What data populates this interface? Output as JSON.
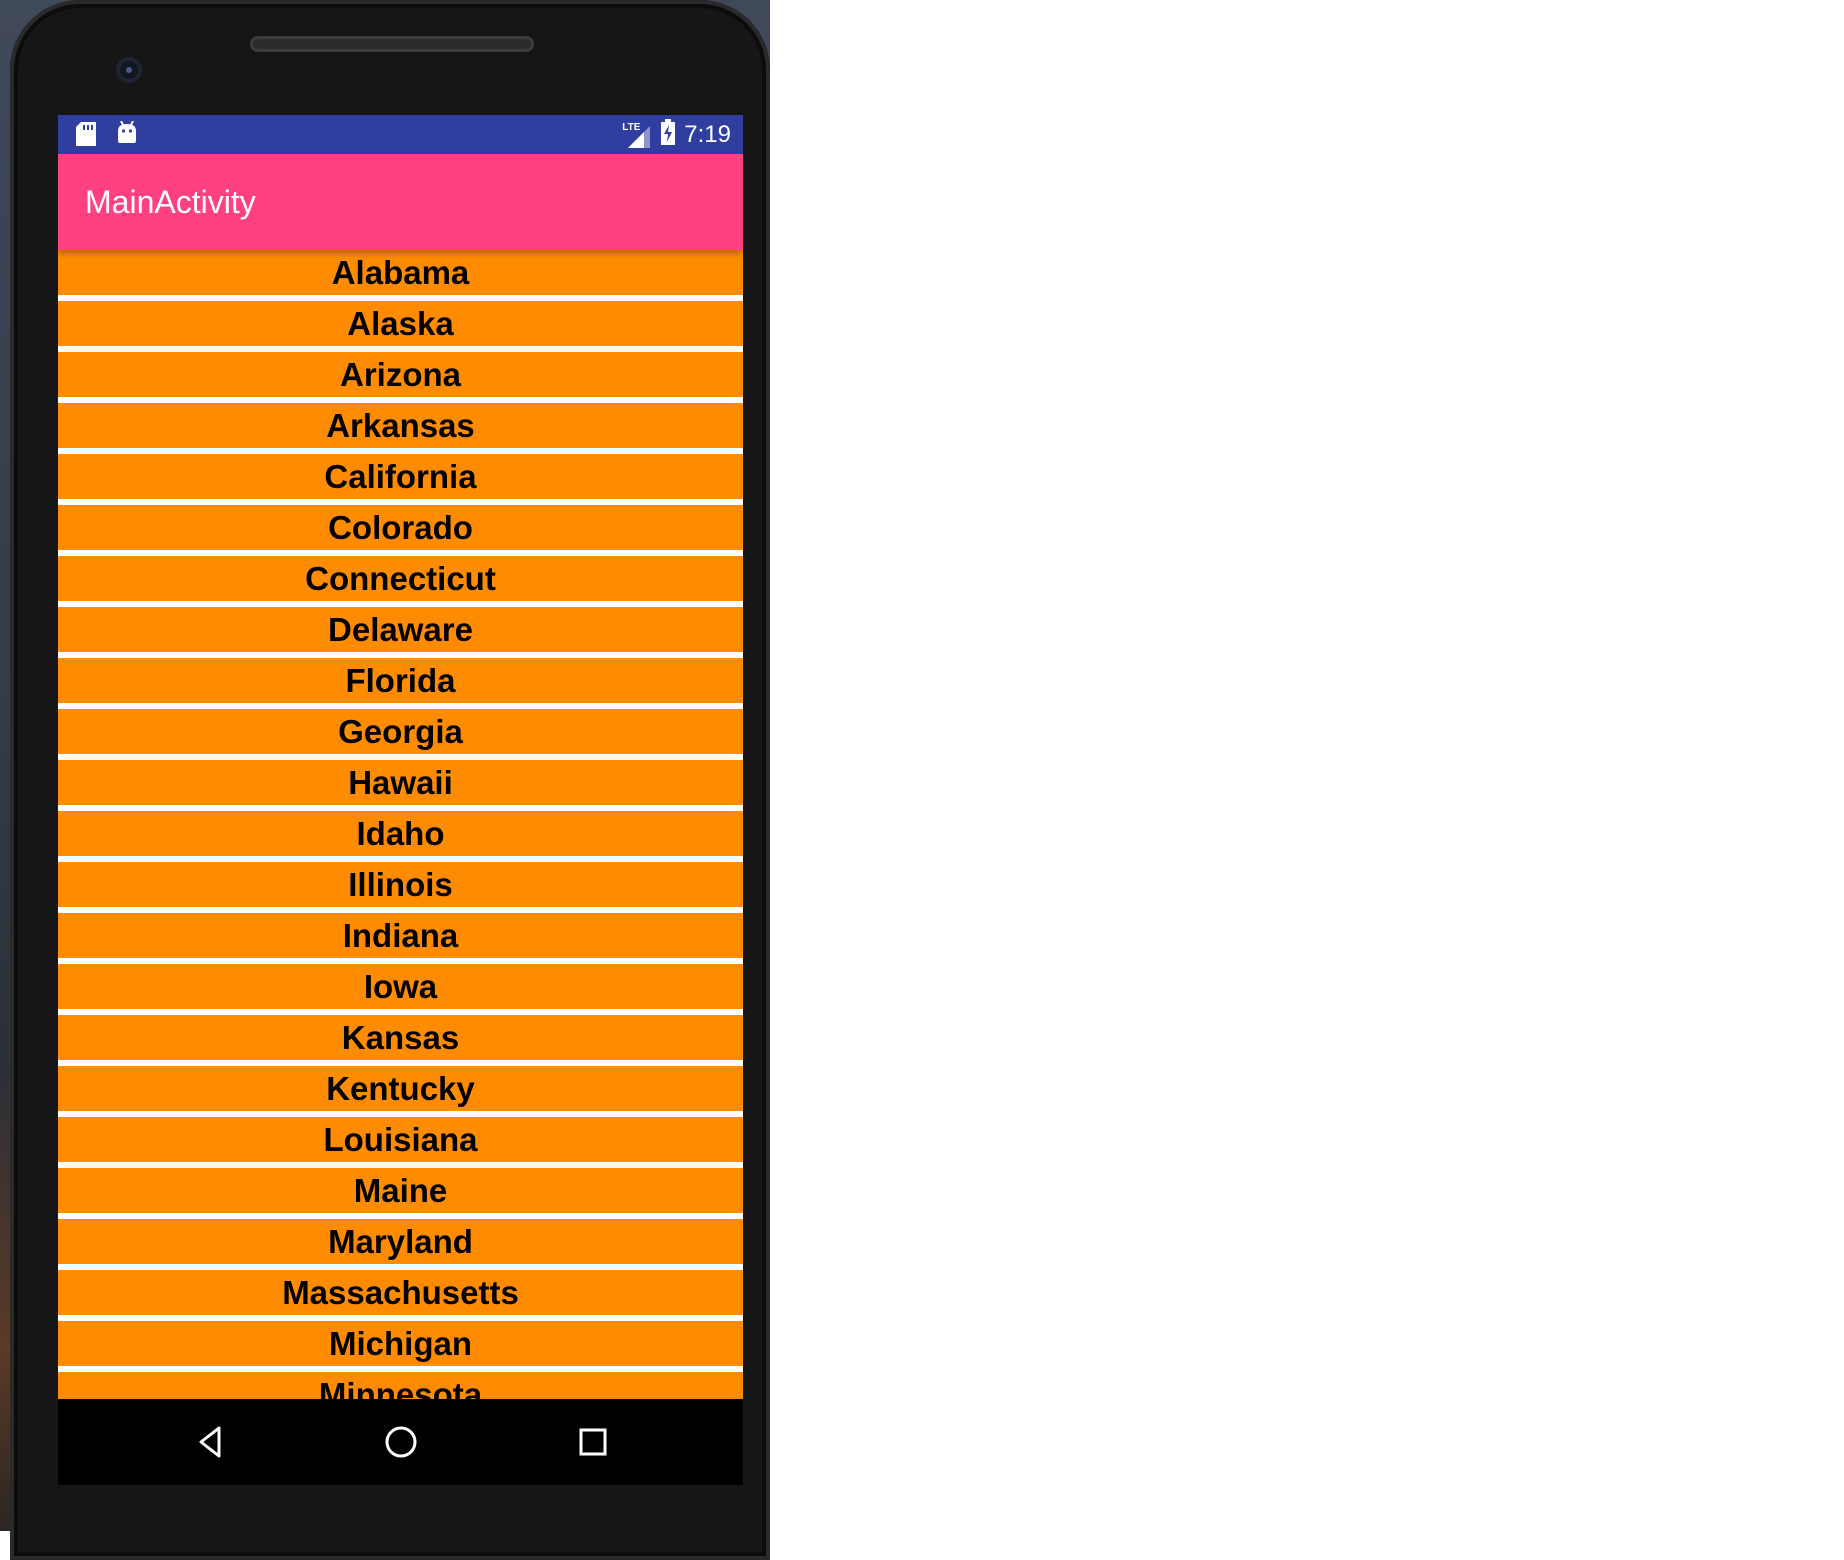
{
  "status_bar": {
    "time": "7:19",
    "network_label": "LTE",
    "icons": [
      "sd-card-icon",
      "android-icon",
      "lte-signal-icon",
      "battery-charging-icon"
    ]
  },
  "app_bar": {
    "title": "MainActivity"
  },
  "states": [
    "Alabama",
    "Alaska",
    "Arizona",
    "Arkansas",
    "California",
    "Colorado",
    "Connecticut",
    "Delaware",
    "Florida",
    "Georgia",
    "Hawaii",
    "Idaho",
    "Illinois",
    "Indiana",
    "Iowa",
    "Kansas",
    "Kentucky",
    "Louisiana",
    "Maine",
    "Maryland",
    "Massachusetts",
    "Michigan",
    "Minnesota"
  ],
  "colors": {
    "status_bar": "#303f9f",
    "app_bar": "#ff4081",
    "list_item": "#ff8c00",
    "divider": "#ffffff"
  },
  "nav_bar": {
    "icons": [
      "back-icon",
      "home-icon",
      "recents-icon"
    ]
  }
}
